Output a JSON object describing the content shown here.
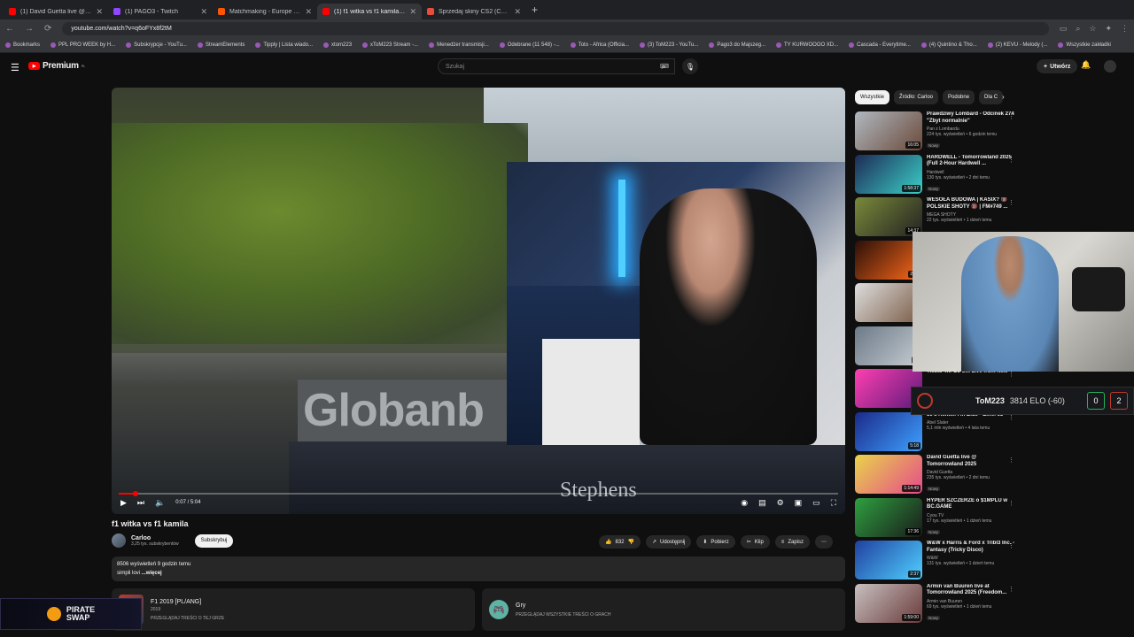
{
  "tabs": [
    {
      "label": "(1) David Guetta live @ To",
      "color": "#ff0000"
    },
    {
      "label": "(1) PAGO3 - Twitch",
      "color": "#9146ff"
    },
    {
      "label": "Matchmaking - Europe 5v5 Qu",
      "color": "#ff5500"
    },
    {
      "label": "(1) f1 witka vs f1 kamila - YouT",
      "color": "#ff0000"
    },
    {
      "label": "Sprzedaj skiny CS2 (CSGO) | N",
      "color": "#e74c3c"
    }
  ],
  "url": "youtube.com/watch?v=q6oFYx8f2tM",
  "bookmarks": [
    "Bookmarks",
    "PPL PRO WEEK by H...",
    "Subskrypcje - YouTu...",
    "StreamElements",
    "Tipply | Lista wiado...",
    "xtom223",
    "xToM223 Stream -...",
    "Menedżer transmisji...",
    "Odebrane (11 548) -...",
    "Toto - Africa (Officia...",
    "(3) ToM223 - YouTu...",
    "Pago3 do Majszeg...",
    "TY KURWOOOO XD...",
    "Cascada - Everytime...",
    "(4) Quintino & Tho...",
    "(2) KEVU - Melody (...",
    "Wszystkie zakładki"
  ],
  "yt": {
    "logo": "Premium",
    "logo_region": "PL",
    "search_placeholder": "Szukaj",
    "create": "Utwórz",
    "time": "0:07 / 5:04",
    "title": "f1 witka vs f1 kamila",
    "channel": "Carloo",
    "subs": "3,25 tys. subskrybentów",
    "subscribe": "Subskrybuj",
    "likes": "832",
    "share": "Udostępnij",
    "download": "Pobierz",
    "clip": "Klip",
    "save": "Zapisz",
    "desc_line1": "8506 wyświetleń  9 godzin temu",
    "desc_line2": "simpli lovi",
    "desc_more": "...więcej",
    "game_title": "F1 2019 [PL/ANG]",
    "game_year": "2019",
    "game_link": "PRZEGLĄDAJ TREŚCI O TEJ GRZE",
    "gry_title": "Gry",
    "gry_link": "PRZEGLĄDAJ WSZYSTKIE TREŚCI O GRACH",
    "video_text1": "Globanb",
    "video_text2": "Stephens"
  },
  "chips": [
    "Wszystkie",
    "Źródło: Carloo",
    "Podobne",
    "Dla C"
  ],
  "reco": [
    {
      "title": "Prawdziwy Lombard - Odcinek 274 \"Zbyt normalnie\"",
      "channel": "Pan z Lombardu",
      "meta": "224 tys. wyświetleń • 6 godzin temu",
      "new": "Nowy",
      "dur": "16:05",
      "c1": "#b0b8c0",
      "c2": "#6b4a3a"
    },
    {
      "title": "HARDWELL - Tomorrowland 2025 (Full 2-Hour Hardwell ...",
      "channel": "Hardwell",
      "meta": "130 tys. wyświetleń • 2 dni temu",
      "new": "Nowy",
      "dur": "1:58:37",
      "c1": "#1e2a55",
      "c2": "#3ad0c8"
    },
    {
      "title": "WESOŁA BUDOWA | KASIX? 🔞 POLSKIE SHOTY 🔞 | FM#749 ...",
      "channel": "MEGA SHOTY",
      "meta": "22 tys. wyświetleń • 1 dzień temu",
      "new": "",
      "dur": "14:37",
      "c1": "#7a8a3a",
      "c2": "#222"
    },
    {
      "title": "",
      "channel": "",
      "meta": "",
      "new": "",
      "dur": "2:36",
      "c1": "#2a0f08",
      "c2": "#ff6a1a"
    },
    {
      "title": "",
      "channel": "",
      "meta": "",
      "new": "",
      "dur": "7",
      "c1": "#dedede",
      "c2": "#7a5a44"
    },
    {
      "title": "",
      "channel": "",
      "meta": "",
      "new": "",
      "dur": "23",
      "c1": "#6c7a88",
      "c2": "#c6ccd2"
    },
    {
      "title": "Tiësto 4hr DJ Set Live from New",
      "channel": "",
      "meta": "",
      "new": "",
      "dur": "",
      "c1": "#ff3fb1",
      "c2": "#5d1a7a"
    },
    {
      "title": "80's Remix: I'm Blue - Eiffel 65",
      "channel": "Abel Slater",
      "meta": "5,1 mln wyświetleń • 4 lata temu",
      "new": "",
      "dur": "5:18",
      "c1": "#1b2a8a",
      "c2": "#3ea0ff"
    },
    {
      "title": "David Guetta live @ Tomorrowland 2025",
      "channel": "David Guetta",
      "meta": "235 tys. wyświetleń • 2 dni temu",
      "new": "Nowy",
      "dur": "1:14:49",
      "c1": "#e8d44a",
      "c2": "#e64a8a"
    },
    {
      "title": "HYPER SZCZERZE o $1MPLU w BC.GAME",
      "channel": "Cyou TV",
      "meta": "17 tys. wyświetleń • 1 dzień temu",
      "new": "Nowy",
      "dur": "17:36",
      "c1": "#2ea040",
      "c2": "#1a1a1a"
    },
    {
      "title": "W&W x Harris & Ford x Tribl3 Inc. - Fantasy (Tricky Disco)",
      "channel": "W&W",
      "meta": "131 tys. wyświetleń • 1 dzień temu",
      "new": "",
      "dur": "2:37",
      "c1": "#2040a0",
      "c2": "#50d0ff"
    },
    {
      "title": "Armin van Buuren live at Tomorrowland 2025 (Freedom...",
      "channel": "Armin van Buuren",
      "meta": "69 tys. wyświetleń • 1 dzień temu",
      "new": "Nowy",
      "dur": "1:59:00",
      "c1": "#c8c0c0",
      "c2": "#6a3a3a"
    }
  ],
  "elo": {
    "name": "ToM223",
    "value": "3814 ELO (-60)",
    "wins": "0",
    "losses": "2"
  },
  "pirate": {
    "l1": "PIRATE",
    "l2": "SWAP"
  },
  "progress": 0.023
}
